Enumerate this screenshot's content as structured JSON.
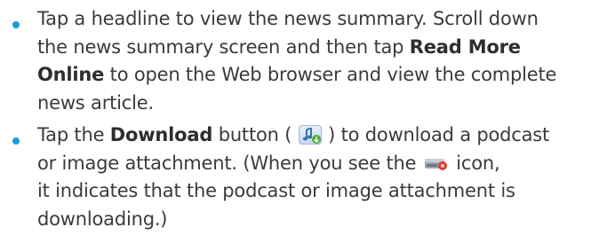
{
  "list": {
    "items": [
      {
        "lines": [
          {
            "t1": "Tap a headline to view the news summary. Scroll down"
          },
          {
            "t1": "the news summary screen and then tap ",
            "b1": "Read More"
          },
          {
            "b1": "Online",
            "t2": " to open the Web browser and view the complete"
          },
          {
            "t1": "news article."
          }
        ]
      },
      {
        "lines": [
          {
            "t1": "Tap the ",
            "b1": "Download",
            "t2": " button ( ",
            "t3": " ) to download a podcast"
          },
          {
            "t1": "or image attachment. (When you see the ",
            "t2": " icon,"
          },
          {
            "t1": "it indicates that the podcast or image attachment is"
          },
          {
            "t1": "downloading.)"
          }
        ]
      }
    ]
  },
  "icons": {
    "download": "download-icon",
    "downloading": "downloading-icon"
  },
  "colors": {
    "bullet": "#1a9bd7",
    "text": "#3b3b3b",
    "icon_green": "#4caf2f",
    "icon_red": "#e03a2a"
  }
}
